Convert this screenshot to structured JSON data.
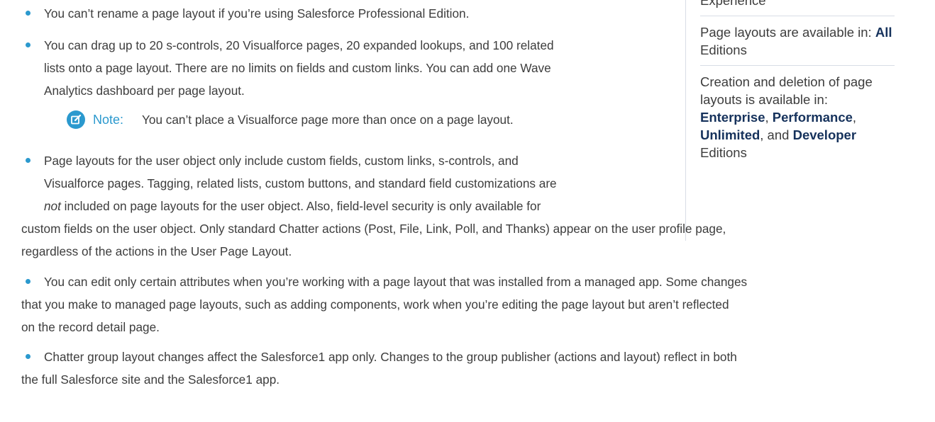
{
  "sidebar": {
    "edition_top_fragment": "Experience",
    "availability": {
      "prefix": "Page layouts are available in: ",
      "bold": "All",
      "suffix": " Editions"
    },
    "creation": {
      "prefix": "Creation and deletion of page layouts is available in: ",
      "e1": "Enterprise",
      "sep1": ", ",
      "e2": "Performance",
      "sep2": ",",
      "e3": "Unlimited",
      "sep3": ", and ",
      "e4": "Developer",
      "suffix": "Editions"
    }
  },
  "bullets": {
    "b1": "You can’t rename a page layout if you’re using Salesforce Professional Edition.",
    "b2_l1": "You can drag up to 20 s-controls, 20 Visualforce pages, 20 expanded lookups, and 100 related",
    "b2_l2": "lists onto a page layout. There are no limits on fields and custom links.  You can add one Wave",
    "b2_l3": "Analytics dashboard per page layout.",
    "note_label": "Note:",
    "note_text": "You can’t place a Visualforce page more than once on a page layout.",
    "b3_l1": "Page layouts for the user object only include custom fields, custom links, s-controls, and",
    "b3_l2": "Visualforce pages. Tagging, related lists, custom buttons, and standard field customizations are",
    "b3_l3_em": "not",
    "b3_l3_rest": " included on page layouts for the user object. Also, field-level security is only available for",
    "b3_l4": "custom fields on the user object. Only standard Chatter actions (Post, File, Link, Poll, and Thanks) appear on the user profile page,",
    "b3_l5": "regardless of the actions in the User Page Layout.",
    "b4_l1": "You can edit only certain attributes when you’re working with a page layout that was installed from a managed app. Some changes",
    "b4_l2": "that you make to managed page layouts, such as adding components, work when you’re editing the page layout but aren’t reflected",
    "b4_l3": "on the record detail page.",
    "b5_l1": "Chatter group layout changes affect the Salesforce1 app only. Changes to the group publisher (actions and layout) reflect in both",
    "b5_l2": "the full Salesforce site and the Salesforce1 app."
  },
  "colors": {
    "accent": "#2b99ce",
    "text": "#3d3d3d",
    "bold": "#16325c",
    "divider": "#d8dde6"
  }
}
